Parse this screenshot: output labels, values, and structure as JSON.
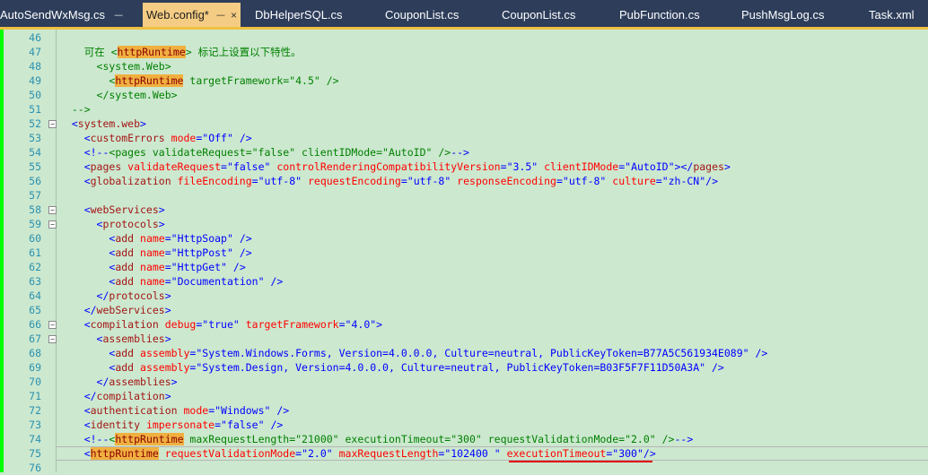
{
  "tabs": [
    {
      "label": "AutoSendWxMsg.cs",
      "state": "pinned"
    },
    {
      "label": "Web.config*",
      "state": "active"
    },
    {
      "label": "DbHelperSQL.cs"
    },
    {
      "label": "CouponList.cs"
    },
    {
      "label": "CouponList.cs"
    },
    {
      "label": "PubFunction.cs"
    },
    {
      "label": "PushMsgLog.cs"
    },
    {
      "label": "Task.xml"
    }
  ],
  "tab_glyphs": {
    "pin": "ᅳ",
    "close": "×",
    "pin_icon_name": "pin-icon",
    "close_icon_name": "close-icon"
  },
  "colors": {
    "editor_bg": "#cce8cf",
    "tab_bg": "#2d3d5a",
    "active_tab": "#f5cc84",
    "line_number": "#2b91af",
    "highlight": "#f0b040",
    "underline": "#e00000"
  },
  "lines": [
    {
      "n": "46",
      "fold": "",
      "segs": []
    },
    {
      "n": "47",
      "fold": "",
      "segs": [
        {
          "c": "c",
          "t": "    可在 <"
        },
        {
          "c": "hl",
          "t": "httpRuntime"
        },
        {
          "c": "c",
          "t": "> 标记上设置以下特性。"
        }
      ]
    },
    {
      "n": "48",
      "fold": "",
      "segs": [
        {
          "c": "c",
          "t": "      <system.Web>"
        }
      ]
    },
    {
      "n": "49",
      "fold": "",
      "segs": [
        {
          "c": "c",
          "t": "        <"
        },
        {
          "c": "hl",
          "t": "httpRuntime"
        },
        {
          "c": "c",
          "t": " targetFramework=\"4.5\" />"
        }
      ]
    },
    {
      "n": "50",
      "fold": "",
      "segs": [
        {
          "c": "c",
          "t": "      </system.Web>"
        }
      ]
    },
    {
      "n": "51",
      "fold": "",
      "segs": [
        {
          "c": "c",
          "t": "  -->"
        }
      ]
    },
    {
      "n": "52",
      "fold": "−",
      "segs": [
        {
          "c": "p",
          "t": "  <"
        },
        {
          "c": "t",
          "t": "system.web"
        },
        {
          "c": "p",
          "t": ">"
        }
      ]
    },
    {
      "n": "53",
      "fold": "",
      "segs": [
        {
          "c": "p",
          "t": "    <"
        },
        {
          "c": "t",
          "t": "customErrors"
        },
        {
          "c": "a",
          "t": " mode"
        },
        {
          "c": "p",
          "t": "="
        },
        {
          "c": "v",
          "t": "\"Off\""
        },
        {
          "c": "p",
          "t": " />"
        }
      ]
    },
    {
      "n": "54",
      "fold": "",
      "segs": [
        {
          "c": "p",
          "t": "    <!--"
        },
        {
          "c": "c",
          "t": "<pages validateRequest=\"false\" clientIDMode=\"AutoID\" />"
        },
        {
          "c": "p",
          "t": "-->"
        }
      ]
    },
    {
      "n": "55",
      "fold": "",
      "segs": [
        {
          "c": "p",
          "t": "    <"
        },
        {
          "c": "t",
          "t": "pages"
        },
        {
          "c": "a",
          "t": " validateRequest"
        },
        {
          "c": "p",
          "t": "="
        },
        {
          "c": "v",
          "t": "\"false\""
        },
        {
          "c": "a",
          "t": " controlRenderingCompatibilityVersion"
        },
        {
          "c": "p",
          "t": "="
        },
        {
          "c": "v",
          "t": "\"3.5\""
        },
        {
          "c": "a",
          "t": " clientIDMode"
        },
        {
          "c": "p",
          "t": "="
        },
        {
          "c": "v",
          "t": "\"AutoID\""
        },
        {
          "c": "p",
          "t": "></"
        },
        {
          "c": "t",
          "t": "pages"
        },
        {
          "c": "p",
          "t": ">"
        }
      ]
    },
    {
      "n": "56",
      "fold": "",
      "segs": [
        {
          "c": "p",
          "t": "    <"
        },
        {
          "c": "t",
          "t": "globalization"
        },
        {
          "c": "a",
          "t": " fileEncoding"
        },
        {
          "c": "p",
          "t": "="
        },
        {
          "c": "v",
          "t": "\"utf-8\""
        },
        {
          "c": "a",
          "t": " requestEncoding"
        },
        {
          "c": "p",
          "t": "="
        },
        {
          "c": "v",
          "t": "\"utf-8\""
        },
        {
          "c": "a",
          "t": " responseEncoding"
        },
        {
          "c": "p",
          "t": "="
        },
        {
          "c": "v",
          "t": "\"utf-8\""
        },
        {
          "c": "a",
          "t": " culture"
        },
        {
          "c": "p",
          "t": "="
        },
        {
          "c": "v",
          "t": "\"zh-CN\""
        },
        {
          "c": "p",
          "t": "/>"
        }
      ]
    },
    {
      "n": "57",
      "fold": "",
      "segs": []
    },
    {
      "n": "58",
      "fold": "−",
      "segs": [
        {
          "c": "p",
          "t": "    <"
        },
        {
          "c": "t",
          "t": "webServices"
        },
        {
          "c": "p",
          "t": ">"
        }
      ]
    },
    {
      "n": "59",
      "fold": "−",
      "segs": [
        {
          "c": "p",
          "t": "      <"
        },
        {
          "c": "t",
          "t": "protocols"
        },
        {
          "c": "p",
          "t": ">"
        }
      ]
    },
    {
      "n": "60",
      "fold": "",
      "segs": [
        {
          "c": "p",
          "t": "        <"
        },
        {
          "c": "t",
          "t": "add"
        },
        {
          "c": "a",
          "t": " name"
        },
        {
          "c": "p",
          "t": "="
        },
        {
          "c": "v",
          "t": "\"HttpSoap\""
        },
        {
          "c": "p",
          "t": " />"
        }
      ]
    },
    {
      "n": "61",
      "fold": "",
      "segs": [
        {
          "c": "p",
          "t": "        <"
        },
        {
          "c": "t",
          "t": "add"
        },
        {
          "c": "a",
          "t": " name"
        },
        {
          "c": "p",
          "t": "="
        },
        {
          "c": "v",
          "t": "\"HttpPost\""
        },
        {
          "c": "p",
          "t": " />"
        }
      ]
    },
    {
      "n": "62",
      "fold": "",
      "segs": [
        {
          "c": "p",
          "t": "        <"
        },
        {
          "c": "t",
          "t": "add"
        },
        {
          "c": "a",
          "t": " name"
        },
        {
          "c": "p",
          "t": "="
        },
        {
          "c": "v",
          "t": "\"HttpGet\""
        },
        {
          "c": "p",
          "t": " />"
        }
      ]
    },
    {
      "n": "63",
      "fold": "",
      "segs": [
        {
          "c": "p",
          "t": "        <"
        },
        {
          "c": "t",
          "t": "add"
        },
        {
          "c": "a",
          "t": " name"
        },
        {
          "c": "p",
          "t": "="
        },
        {
          "c": "v",
          "t": "\"Documentation\""
        },
        {
          "c": "p",
          "t": " />"
        }
      ]
    },
    {
      "n": "64",
      "fold": "",
      "segs": [
        {
          "c": "p",
          "t": "      </"
        },
        {
          "c": "t",
          "t": "protocols"
        },
        {
          "c": "p",
          "t": ">"
        }
      ]
    },
    {
      "n": "65",
      "fold": "",
      "segs": [
        {
          "c": "p",
          "t": "    </"
        },
        {
          "c": "t",
          "t": "webServices"
        },
        {
          "c": "p",
          "t": ">"
        }
      ]
    },
    {
      "n": "66",
      "fold": "−",
      "segs": [
        {
          "c": "p",
          "t": "    <"
        },
        {
          "c": "t",
          "t": "compilation"
        },
        {
          "c": "a",
          "t": " debug"
        },
        {
          "c": "p",
          "t": "="
        },
        {
          "c": "v",
          "t": "\"true\""
        },
        {
          "c": "a",
          "t": " targetFramework"
        },
        {
          "c": "p",
          "t": "="
        },
        {
          "c": "v",
          "t": "\"4.0\""
        },
        {
          "c": "p",
          "t": ">"
        }
      ]
    },
    {
      "n": "67",
      "fold": "−",
      "segs": [
        {
          "c": "p",
          "t": "      <"
        },
        {
          "c": "t",
          "t": "assemblies"
        },
        {
          "c": "p",
          "t": ">"
        }
      ]
    },
    {
      "n": "68",
      "fold": "",
      "segs": [
        {
          "c": "p",
          "t": "        <"
        },
        {
          "c": "t",
          "t": "add"
        },
        {
          "c": "a",
          "t": " assembly"
        },
        {
          "c": "p",
          "t": "="
        },
        {
          "c": "v",
          "t": "\"System.Windows.Forms, Version=4.0.0.0, Culture=neutral, PublicKeyToken=B77A5C561934E089\""
        },
        {
          "c": "p",
          "t": " />"
        }
      ]
    },
    {
      "n": "69",
      "fold": "",
      "segs": [
        {
          "c": "p",
          "t": "        <"
        },
        {
          "c": "t",
          "t": "add"
        },
        {
          "c": "a",
          "t": " assembly"
        },
        {
          "c": "p",
          "t": "="
        },
        {
          "c": "v",
          "t": "\"System.Design, Version=4.0.0.0, Culture=neutral, PublicKeyToken=B03F5F7F11D50A3A\""
        },
        {
          "c": "p",
          "t": " />"
        }
      ]
    },
    {
      "n": "70",
      "fold": "",
      "segs": [
        {
          "c": "p",
          "t": "      </"
        },
        {
          "c": "t",
          "t": "assemblies"
        },
        {
          "c": "p",
          "t": ">"
        }
      ]
    },
    {
      "n": "71",
      "fold": "",
      "segs": [
        {
          "c": "p",
          "t": "    </"
        },
        {
          "c": "t",
          "t": "compilation"
        },
        {
          "c": "p",
          "t": ">"
        }
      ]
    },
    {
      "n": "72",
      "fold": "",
      "segs": [
        {
          "c": "p",
          "t": "    <"
        },
        {
          "c": "t",
          "t": "authentication"
        },
        {
          "c": "a",
          "t": " mode"
        },
        {
          "c": "p",
          "t": "="
        },
        {
          "c": "v",
          "t": "\"Windows\""
        },
        {
          "c": "p",
          "t": " />"
        }
      ]
    },
    {
      "n": "73",
      "fold": "",
      "segs": [
        {
          "c": "p",
          "t": "    <"
        },
        {
          "c": "t",
          "t": "identity"
        },
        {
          "c": "a",
          "t": " impersonate"
        },
        {
          "c": "p",
          "t": "="
        },
        {
          "c": "v",
          "t": "\"false\""
        },
        {
          "c": "p",
          "t": " />"
        }
      ]
    },
    {
      "n": "74",
      "fold": "",
      "segs": [
        {
          "c": "p",
          "t": "    <!--"
        },
        {
          "c": "c",
          "t": "<"
        },
        {
          "c": "hl",
          "t": "httpRuntime"
        },
        {
          "c": "c",
          "t": " maxRequestLength=\"21000\" executionTimeout=\"300\" requestValidationMode=\"2.0\" />"
        },
        {
          "c": "p",
          "t": "-->"
        }
      ]
    },
    {
      "n": "75",
      "fold": "",
      "segs": [
        {
          "c": "p",
          "t": "    <"
        },
        {
          "c": "hl",
          "t": "httpRuntime"
        },
        {
          "c": "a",
          "t": " requestValidationMode"
        },
        {
          "c": "p",
          "t": "="
        },
        {
          "c": "v",
          "t": "\"2.0\""
        },
        {
          "c": "a",
          "t": " maxRequestLength"
        },
        {
          "c": "p",
          "t": "="
        },
        {
          "c": "v",
          "t": "\"102400 \""
        },
        {
          "c": "a",
          "t": " executionTimeout"
        },
        {
          "c": "p",
          "t": "="
        },
        {
          "c": "v",
          "t": "\"300\""
        },
        {
          "c": "p",
          "t": "/>"
        }
      ]
    },
    {
      "n": "76",
      "fold": "",
      "segs": []
    }
  ]
}
